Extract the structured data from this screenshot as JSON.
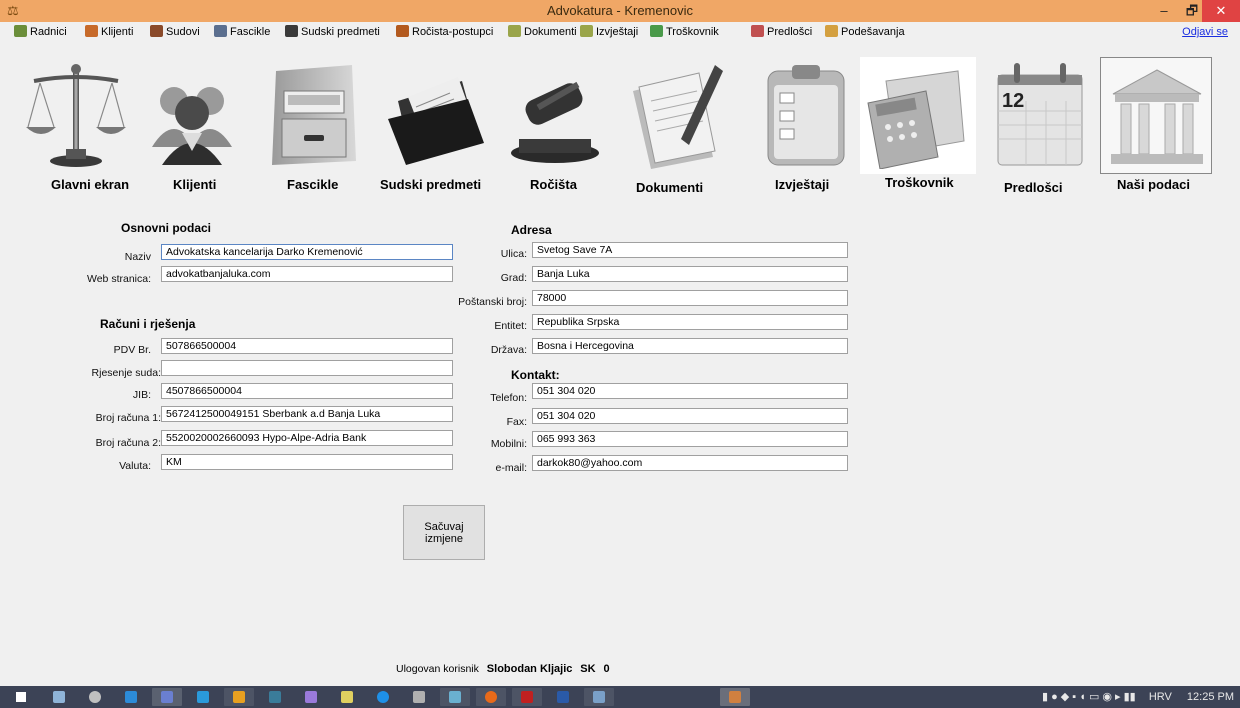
{
  "window": {
    "title": "Advokatura - Kremenovic",
    "min": "–",
    "max": "🗗",
    "close": "✕"
  },
  "menu": {
    "items": [
      {
        "label": "Radnici",
        "color": "#6b8e3a"
      },
      {
        "label": "Klijenti",
        "color": "#c76a2a"
      },
      {
        "label": "Sudovi",
        "color": "#8a4a2a"
      },
      {
        "label": "Fascikle",
        "color": "#5b6f8f"
      },
      {
        "label": "Sudski predmeti",
        "color": "#3a3a3a"
      },
      {
        "label": "Ročista-postupci",
        "color": "#b35a1f"
      },
      {
        "label": "Dokumenti",
        "color": "#9aa54a"
      },
      {
        "label": "Izvještaji",
        "color": "#9aa54a"
      },
      {
        "label": "Troškovnik",
        "color": "#4a9a4a"
      },
      {
        "label": "Predlošci",
        "color": "#c05050"
      },
      {
        "label": "Podešavanja",
        "color": "#d4a040"
      }
    ],
    "logout": "Odjavi se"
  },
  "nav": [
    {
      "label": "Glavni ekran",
      "icon": "scales-icon"
    },
    {
      "label": "Klijenti",
      "icon": "clients-icon"
    },
    {
      "label": "Fascikle",
      "icon": "filing-cabinet-icon"
    },
    {
      "label": "Sudski predmeti",
      "icon": "folder-icon"
    },
    {
      "label": "Ročišta",
      "icon": "gavel-icon"
    },
    {
      "label": "Dokumenti",
      "icon": "documents-icon"
    },
    {
      "label": "Izvještaji",
      "icon": "clipboard-icon"
    },
    {
      "label": "Troškovnik",
      "icon": "calculator-icon"
    },
    {
      "label": "Predlošci",
      "icon": "calendar-icon"
    },
    {
      "label": "Naši podaci",
      "icon": "courthouse-icon"
    }
  ],
  "calendar_day": "12",
  "basic": {
    "title": "Osnovni podaci",
    "naziv_label": "Naziv",
    "naziv": "Advokatska kancelarija Darko Kremenović",
    "web_label": "Web stranica:",
    "web": "advokatbanjaluka.com"
  },
  "accounts": {
    "title": "Računi i rješenja",
    "pdv_label": "PDV Br.",
    "pdv": "507866500004",
    "rjesenje_label": "Rjesenje suda:",
    "rjesenje": "",
    "jib_label": "JIB:",
    "jib": "4507866500004",
    "racun1_label": "Broj računa 1:",
    "racun1": "5672412500049151 Sberbank a.d Banja Luka",
    "racun2_label": "Broj računa 2:",
    "racun2": "5520020002660093 Hypo-Alpe-Adria Bank",
    "valuta_label": "Valuta:",
    "valuta": "KM"
  },
  "address": {
    "title": "Adresa",
    "ulica_label": "Ulica:",
    "ulica": "Svetog Save 7A",
    "grad_label": "Grad:",
    "grad": "Banja Luka",
    "postanski_label": "Poštanski broj:",
    "postanski": "78000",
    "entitet_label": "Entitet:",
    "entitet": "Republika Srpska",
    "drzava_label": "Država:",
    "drzava": "Bosna i Hercegovina"
  },
  "contact": {
    "title": "Kontakt:",
    "telefon_label": "Telefon:",
    "telefon": "051 304 020",
    "fax_label": "Fax:",
    "fax": "051 304 020",
    "mobilni_label": "Mobilni:",
    "mobilni": "065 993 363",
    "email_label": "e-mail:",
    "email": "darkok80@yahoo.com"
  },
  "save_label": "Sačuvaj izmjene",
  "status": {
    "label": "Ulogovan korisnik",
    "user": "Slobodan Kljajic",
    "code": "SK",
    "count": "0"
  },
  "taskbar": {
    "lang": "HRV",
    "time": "12:25 PM"
  }
}
